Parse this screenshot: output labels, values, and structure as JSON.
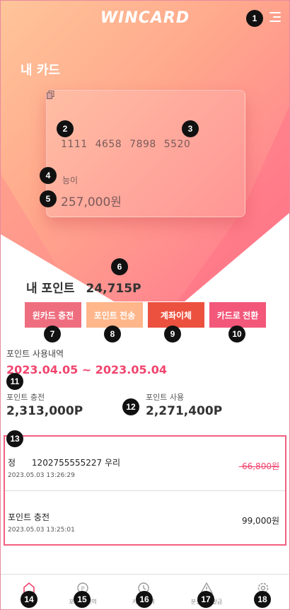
{
  "header": {
    "logo": "WINCARD",
    "menu_icon": "hamburger-menu-icon"
  },
  "section_title": "내 카드",
  "card": {
    "number": "1111 4658 7898 5520",
    "copy_icon": "copy-icon",
    "holder": "능이",
    "balance": "257,000원"
  },
  "points": {
    "label": "내 포인트",
    "value": "24,715P"
  },
  "actions": [
    {
      "label": "윈카드 충전",
      "color": "#ee6e7f"
    },
    {
      "label": "포인트 전송",
      "color": "#ffb68a"
    },
    {
      "label": "계좌이체",
      "color": "#ec5140"
    },
    {
      "label": "카드로 전환",
      "color": "#f3577a"
    }
  ],
  "history": {
    "label": "포인트 사용내역",
    "range": "2023.04.05 ~ 2023.05.04",
    "charge_label": "포인트 충전",
    "charge_value": "2,313,000P",
    "use_label": "포인트 사용",
    "use_value": "2,271,400P"
  },
  "transactions": [
    {
      "title": "정      1202755555227 우리",
      "date": "2023.05.03 13:26:29",
      "amount": "-66,800원",
      "negative": true
    },
    {
      "title": "포인트 충전",
      "date": "2023.05.03 13:25:01",
      "amount": "99,000원",
      "negative": false
    }
  ],
  "nav": [
    {
      "label": "홈",
      "icon": "home-icon",
      "active": true
    },
    {
      "label": "포인트 내역",
      "icon": "point-history-icon",
      "active": false
    },
    {
      "label": "카드 내역",
      "icon": "card-history-icon",
      "active": false
    },
    {
      "label": "분실 / 재발급",
      "icon": "warning-icon",
      "active": false
    },
    {
      "label": "설정",
      "icon": "settings-icon",
      "active": false
    }
  ],
  "badges": [
    "1",
    "2",
    "3",
    "4",
    "5",
    "6",
    "7",
    "8",
    "9",
    "10",
    "11",
    "12",
    "13",
    "14",
    "15",
    "16",
    "17",
    "18"
  ],
  "colors": {
    "accent": "#f0456e",
    "list_border": "#f26080"
  }
}
